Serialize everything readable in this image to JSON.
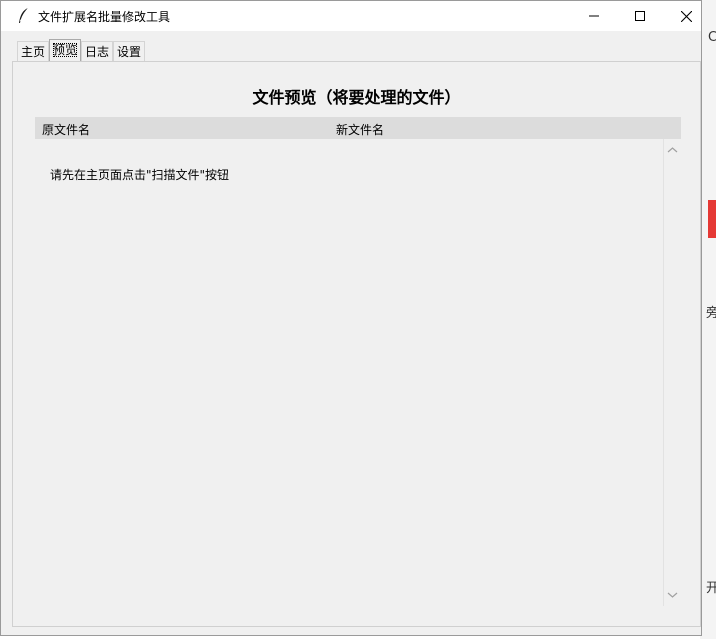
{
  "window": {
    "title": "文件扩展名批量修改工具",
    "controls": {
      "minimize_icon": "minimize-icon",
      "maximize_icon": "maximize-icon",
      "close_icon": "close-icon"
    }
  },
  "tabs": [
    {
      "label": "主页",
      "active": false
    },
    {
      "label": "预览",
      "active": true
    },
    {
      "label": "日志",
      "active": false
    },
    {
      "label": "设置",
      "active": false
    }
  ],
  "preview": {
    "heading": "文件预览（将要处理的文件）",
    "columns": [
      "原文件名",
      "新文件名"
    ],
    "empty_message": "请先在主页面点击\"扫描文件\"按钮"
  },
  "background": {
    "glyphs": [
      "C",
      "旁",
      "开"
    ]
  },
  "colors": {
    "window_bg": "#f0f0f0",
    "header_bg": "#dcdcdc",
    "accent_red": "#e53935"
  }
}
